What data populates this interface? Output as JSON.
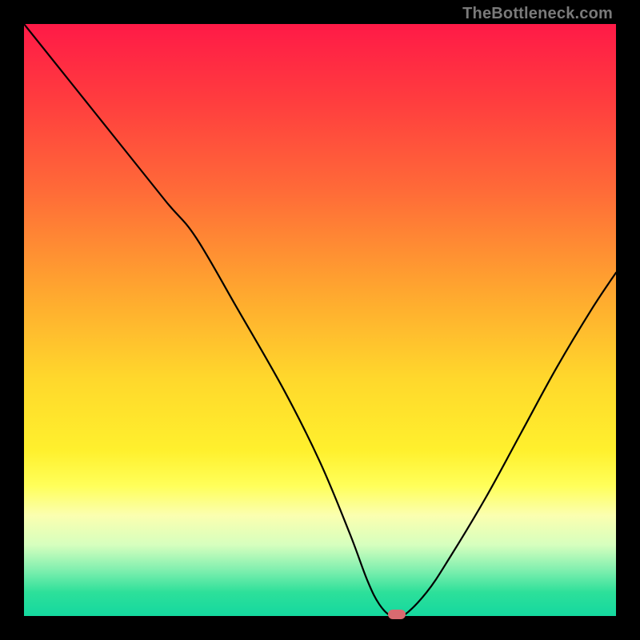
{
  "watermark": "TheBottleneck.com",
  "colors": {
    "frame": "#000000",
    "gradient_top": "#ff1a47",
    "gradient_bottom": "#14d89f",
    "curve": "#000000",
    "marker": "#d96a70",
    "watermark": "#7a7a7a"
  },
  "chart_data": {
    "type": "line",
    "title": "",
    "xlabel": "",
    "ylabel": "",
    "xlim": [
      0,
      100
    ],
    "ylim": [
      0,
      100
    ],
    "grid": false,
    "legend": false,
    "series": [
      {
        "name": "bottleneck-curve",
        "x": [
          0,
          8,
          16,
          24,
          29,
          36,
          44,
          50,
          55,
          58,
          60,
          62,
          64,
          68,
          72,
          78,
          84,
          90,
          96,
          100
        ],
        "values": [
          100,
          90,
          80,
          70,
          64,
          52,
          38,
          26,
          14,
          6,
          2,
          0,
          0,
          4,
          10,
          20,
          31,
          42,
          52,
          58
        ]
      }
    ],
    "marker": {
      "x": 63,
      "y": 0
    },
    "notes": "Axes have no visible tick labels; values are relative percent estimates read from position within the plot area."
  }
}
